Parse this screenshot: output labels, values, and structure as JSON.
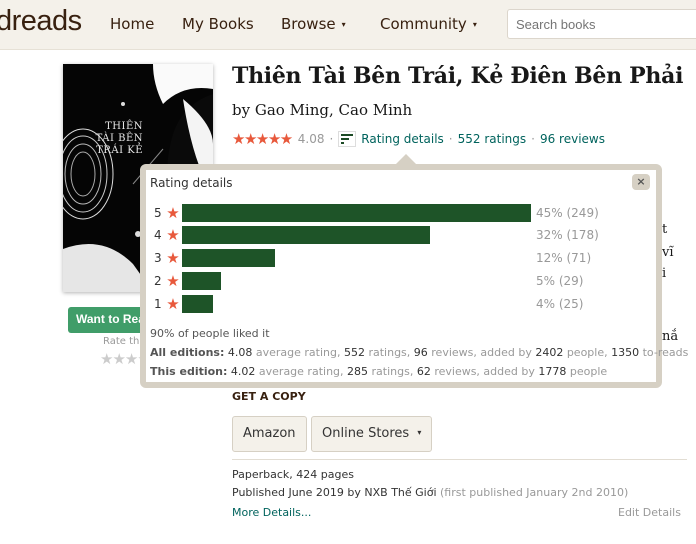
{
  "header": {
    "logo": "dreads",
    "nav": [
      {
        "label": "Home",
        "has_caret": false
      },
      {
        "label": "My Books",
        "has_caret": false
      },
      {
        "label": "Browse",
        "has_caret": true
      },
      {
        "label": "Community",
        "has_caret": true
      }
    ],
    "caret": "▾",
    "search_placeholder": "Search books"
  },
  "cover": {
    "title_lines": "THIÊN TÀI BÊN TRÁI KẺ"
  },
  "sidebar": {
    "want_to_read": "Want to Read",
    "rate_this": "Rate this book",
    "rate_stars": "★★★★★"
  },
  "book": {
    "title": "Thiên Tài Bên Trái, Kẻ Điên Bên Phải",
    "authors": "by Gao Ming, Cao Minh",
    "stars": "★★★★★",
    "avg_rating": "4.08",
    "separator": "·",
    "rating_details_link": "Rating details",
    "ratings_link": "552 ratings",
    "reviews_link": "96 reviews"
  },
  "background_text": [
    "́t",
    "vĩ",
    "i",
    "nắ"
  ],
  "popup": {
    "title": "Rating details",
    "close": "×",
    "star_glyph": "★",
    "distribution": [
      {
        "stars": "5",
        "percent": 45,
        "count": 249,
        "label": "45% (249)"
      },
      {
        "stars": "4",
        "percent": 32,
        "count": 178,
        "label": "32% (178)"
      },
      {
        "stars": "3",
        "percent": 12,
        "count": 71,
        "label": "12% (71)"
      },
      {
        "stars": "2",
        "percent": 5,
        "count": 29,
        "label": "5% (29)"
      },
      {
        "stars": "1",
        "percent": 4,
        "count": 25,
        "label": "4% (25)"
      }
    ],
    "liked": "90% of people liked it",
    "all_editions": {
      "label": "All editions:",
      "avg": "4.08",
      "t1": " average rating, ",
      "ratings": "552",
      "t2": " ratings, ",
      "reviews": "96",
      "t3": " reviews, added by ",
      "people": "2402",
      "t4": " people, ",
      "toreads": "1350",
      "t5": " to-reads"
    },
    "this_edition": {
      "label": "This edition:",
      "avg": "4.02",
      "t1": " average rating, ",
      "ratings": "285",
      "t2": " ratings, ",
      "reviews": "62",
      "t3": " reviews, added by ",
      "people": "1778",
      "t4": " people"
    }
  },
  "get_copy": {
    "heading": "GET A COPY",
    "amazon": "Amazon",
    "online_stores": "Online Stores",
    "caret": "▾"
  },
  "details": {
    "format": "Paperback, 424 pages",
    "published": "Published June 2019 by NXB Thế Giới",
    "first_published": "(first published January 2nd 2010)",
    "more_details": "More Details...",
    "edit_details": "Edit Details"
  },
  "colors": {
    "bar": "#1e5428",
    "star": "#e8593c",
    "link": "#00635d",
    "header_bg": "#f4f1ea",
    "want_button": "#409d69"
  }
}
